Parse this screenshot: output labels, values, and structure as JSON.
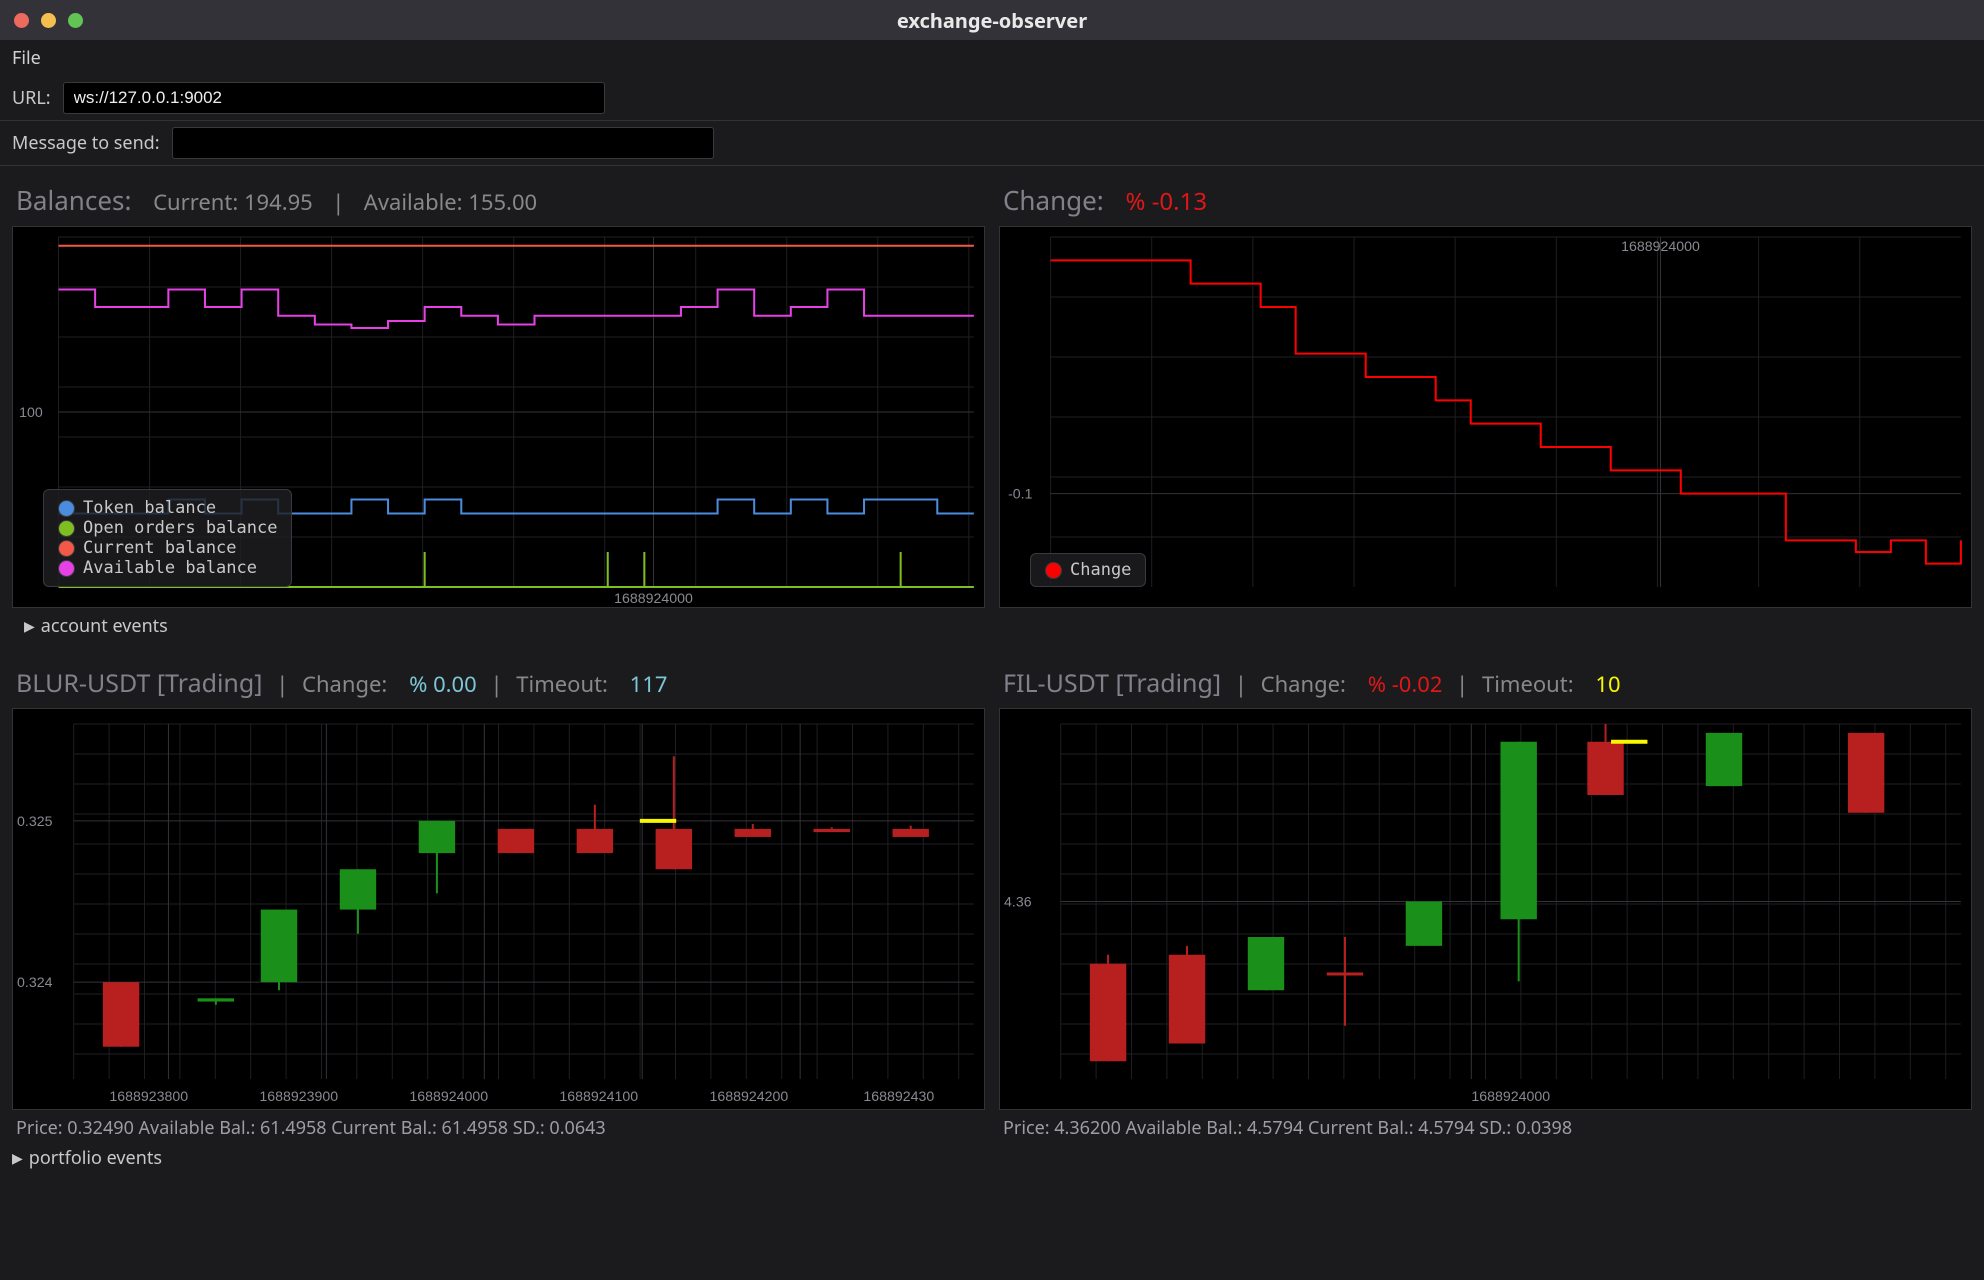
{
  "window": {
    "title": "exchange-observer"
  },
  "menubar": {
    "file_label": "File"
  },
  "url": {
    "label": "URL:",
    "value": "ws://127.0.0.1:9002"
  },
  "message": {
    "label": "Message to send:",
    "value": ""
  },
  "balances": {
    "label": "Balances:",
    "current_label": "Current: 194.95",
    "available_label": "Available: 155.00",
    "y_tick": "100",
    "x_tick": "1688924000",
    "legend": {
      "token": "Token balance",
      "open_orders": "Open orders balance",
      "current": "Current balance",
      "available": "Available balance"
    },
    "disclosure": "account events",
    "colors": {
      "token": "#4a8dde",
      "open": "#7fbe20",
      "current": "#f35848",
      "available": "#e541e5"
    }
  },
  "change_panel": {
    "label": "Change:",
    "value": "% -0.13",
    "y_tick": "-0.1",
    "x_tick": "1688924000",
    "legend_label": "Change",
    "color": "#ff0000"
  },
  "pair1": {
    "symbol": "BLUR-USDT [Trading]",
    "change_label": "Change:",
    "change_value": "% 0.00",
    "timeout_label": "Timeout:",
    "timeout_value": "117",
    "y_ticks": [
      "0.325",
      "0.324"
    ],
    "x_ticks": [
      "1688923800",
      "1688923900",
      "1688924000",
      "1688924100",
      "1688924200",
      "168892430"
    ],
    "stats": "Price: 0.32490   Available Bal.: 61.4958   Current Bal.: 61.4958   SD.: 0.0643"
  },
  "pair2": {
    "symbol": "FIL-USDT [Trading]",
    "change_label": "Change:",
    "change_value": "% -0.02",
    "timeout_label": "Timeout:",
    "timeout_value": "10",
    "y_tick": "4.36",
    "x_ticks": [
      "1688924000"
    ],
    "stats": "Price: 4.36200   Available Bal.: 4.5794   Current Bal.: 4.5794   SD.: 0.0398"
  },
  "portfolio": {
    "disclosure": "portfolio events"
  },
  "chart_data": [
    {
      "id": "balances",
      "type": "line",
      "title": "Balances",
      "x_tick": 1688924000,
      "ylim": [
        0,
        200
      ],
      "series": [
        {
          "name": "Token balance",
          "color": "#4a8dde",
          "shape": "step",
          "values": [
            42,
            42,
            42,
            50,
            42,
            50,
            42,
            42,
            50,
            42,
            50,
            42,
            42,
            42,
            42,
            42,
            42,
            42,
            50,
            42,
            50,
            42,
            50,
            50,
            42,
            42
          ]
        },
        {
          "name": "Open orders balance",
          "color": "#7fbe20",
          "shape": "line-flat",
          "values": [
            0,
            0,
            0,
            0,
            0,
            0,
            0,
            0,
            0,
            0,
            0,
            0,
            0,
            0,
            0,
            0,
            0,
            0,
            0,
            0,
            0,
            0,
            0,
            0,
            0,
            0
          ],
          "spikes_at": [
            10,
            15,
            16,
            23
          ]
        },
        {
          "name": "Current balance",
          "color": "#f35848",
          "shape": "line-flat",
          "values": [
            195,
            195,
            195,
            195,
            195,
            195,
            195,
            195,
            195,
            195,
            195,
            195,
            195,
            195,
            195,
            195,
            195,
            195,
            195,
            195,
            195,
            195,
            195,
            195,
            195,
            195
          ]
        },
        {
          "name": "Available balance",
          "color": "#e541e5",
          "shape": "step",
          "values": [
            170,
            160,
            160,
            170,
            160,
            170,
            155,
            150,
            148,
            152,
            160,
            155,
            150,
            155,
            155,
            155,
            155,
            160,
            170,
            155,
            160,
            170,
            155,
            155,
            155,
            155
          ]
        }
      ]
    },
    {
      "id": "change",
      "type": "line",
      "title": "Change",
      "x_tick": 1688924000,
      "ylim": [
        -0.14,
        0.01
      ],
      "series": [
        {
          "name": "Change",
          "color": "#ff0000",
          "shape": "step",
          "values": [
            0,
            0,
            0,
            0,
            -0.01,
            -0.01,
            -0.02,
            -0.04,
            -0.04,
            -0.05,
            -0.05,
            -0.06,
            -0.07,
            -0.07,
            -0.08,
            -0.08,
            -0.09,
            -0.09,
            -0.1,
            -0.1,
            -0.1,
            -0.12,
            -0.12,
            -0.125,
            -0.12,
            -0.13,
            -0.12
          ]
        }
      ]
    },
    {
      "id": "blur_usdt",
      "type": "candlestick",
      "title": "BLUR-USDT",
      "ylim": [
        0.3234,
        0.3256
      ],
      "xlim": [
        1688923740,
        1688924310
      ],
      "candles": [
        {
          "t": 1688923770,
          "o": 0.324,
          "h": 0.324,
          "l": 0.3236,
          "c": 0.3236,
          "dir": "down"
        },
        {
          "t": 1688923830,
          "o": 0.32388,
          "h": 0.3239,
          "l": 0.32386,
          "c": 0.3239,
          "dir": "up"
        },
        {
          "t": 1688923870,
          "o": 0.324,
          "h": 0.32445,
          "l": 0.32395,
          "c": 0.32445,
          "dir": "up"
        },
        {
          "t": 1688923920,
          "o": 0.32445,
          "h": 0.3247,
          "l": 0.3243,
          "c": 0.3247,
          "dir": "up"
        },
        {
          "t": 1688923970,
          "o": 0.3248,
          "h": 0.325,
          "l": 0.32455,
          "c": 0.325,
          "dir": "up"
        },
        {
          "t": 1688924020,
          "o": 0.32495,
          "h": 0.32495,
          "l": 0.3248,
          "c": 0.3248,
          "dir": "down"
        },
        {
          "t": 1688924070,
          "o": 0.32495,
          "h": 0.3251,
          "l": 0.3248,
          "c": 0.3248,
          "dir": "down"
        },
        {
          "t": 1688924120,
          "o": 0.32495,
          "h": 0.3254,
          "l": 0.3247,
          "c": 0.3247,
          "dir": "down"
        },
        {
          "t": 1688924170,
          "o": 0.32495,
          "h": 0.32498,
          "l": 0.3249,
          "c": 0.3249,
          "dir": "down"
        },
        {
          "t": 1688924220,
          "o": 0.32495,
          "h": 0.32496,
          "l": 0.32493,
          "c": 0.32493,
          "dir": "down"
        },
        {
          "t": 1688924270,
          "o": 0.32495,
          "h": 0.32497,
          "l": 0.3249,
          "c": 0.3249,
          "dir": "down"
        }
      ],
      "marker": {
        "t": 1688924110,
        "price": 0.325,
        "color": "#f7f700"
      }
    },
    {
      "id": "fil_usdt",
      "type": "candlestick",
      "title": "FIL-USDT",
      "ylim": [
        4.35,
        4.37
      ],
      "xlim": [
        1688923740,
        1688924310
      ],
      "candles": [
        {
          "t": 1688923770,
          "o": 4.3565,
          "h": 4.357,
          "l": 4.351,
          "c": 4.351,
          "dir": "down"
        },
        {
          "t": 1688923820,
          "o": 4.357,
          "h": 4.3575,
          "l": 4.352,
          "c": 4.352,
          "dir": "down"
        },
        {
          "t": 1688923870,
          "o": 4.355,
          "h": 4.358,
          "l": 4.355,
          "c": 4.358,
          "dir": "up"
        },
        {
          "t": 1688923920,
          "o": 4.356,
          "h": 4.358,
          "l": 4.353,
          "c": 4.356,
          "dir": "down"
        },
        {
          "t": 1688923970,
          "o": 4.3575,
          "h": 4.36,
          "l": 4.3575,
          "c": 4.36,
          "dir": "up"
        },
        {
          "t": 1688924030,
          "o": 4.359,
          "h": 4.369,
          "l": 4.3555,
          "c": 4.369,
          "dir": "up"
        },
        {
          "t": 1688924085,
          "o": 4.369,
          "h": 4.37,
          "l": 4.366,
          "c": 4.366,
          "dir": "down"
        },
        {
          "t": 1688924160,
          "o": 4.3665,
          "h": 4.3695,
          "l": 4.3665,
          "c": 4.3695,
          "dir": "up"
        },
        {
          "t": 1688924250,
          "o": 4.3695,
          "h": 4.3695,
          "l": 4.365,
          "c": 4.365,
          "dir": "down"
        }
      ],
      "marker": {
        "t": 1688924100,
        "price": 4.369,
        "color": "#f7f700"
      }
    }
  ]
}
